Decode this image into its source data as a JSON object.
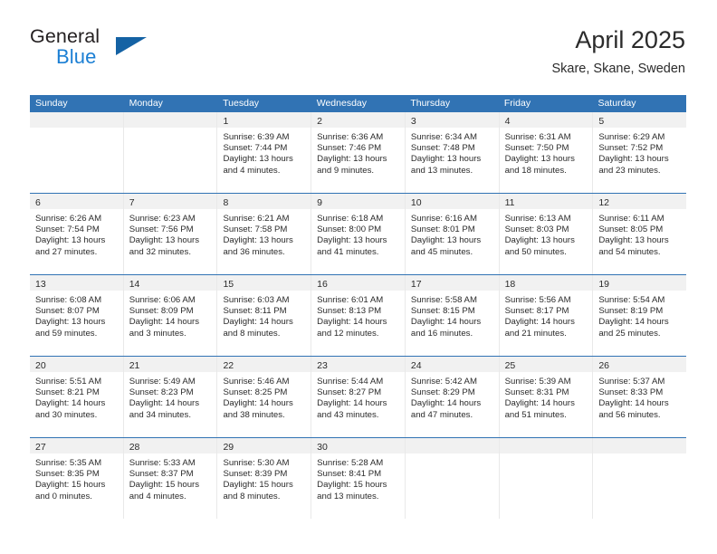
{
  "brand": {
    "name_dark": "General",
    "name_blue": "Blue",
    "triangle_color": "#1462a4",
    "blue_color": "#1b7fd4"
  },
  "header": {
    "title": "April 2025",
    "location": "Skare, Skane, Sweden"
  },
  "theme": {
    "header_blue": "#3173b4",
    "date_band_gray": "#f1f1f1",
    "text": "#2b2b2b"
  },
  "weekdays": [
    "Sunday",
    "Monday",
    "Tuesday",
    "Wednesday",
    "Thursday",
    "Friday",
    "Saturday"
  ],
  "labels": {
    "sunrise_prefix": "Sunrise:",
    "sunset_prefix": "Sunset:",
    "daylight_prefix": "Daylight:"
  },
  "weeks": [
    [
      {
        "date": "",
        "sunrise": "",
        "sunset": "",
        "daylight": ""
      },
      {
        "date": "",
        "sunrise": "",
        "sunset": "",
        "daylight": ""
      },
      {
        "date": "1",
        "sunrise": "Sunrise: 6:39 AM",
        "sunset": "Sunset: 7:44 PM",
        "daylight": "Daylight: 13 hours and 4 minutes."
      },
      {
        "date": "2",
        "sunrise": "Sunrise: 6:36 AM",
        "sunset": "Sunset: 7:46 PM",
        "daylight": "Daylight: 13 hours and 9 minutes."
      },
      {
        "date": "3",
        "sunrise": "Sunrise: 6:34 AM",
        "sunset": "Sunset: 7:48 PM",
        "daylight": "Daylight: 13 hours and 13 minutes."
      },
      {
        "date": "4",
        "sunrise": "Sunrise: 6:31 AM",
        "sunset": "Sunset: 7:50 PM",
        "daylight": "Daylight: 13 hours and 18 minutes."
      },
      {
        "date": "5",
        "sunrise": "Sunrise: 6:29 AM",
        "sunset": "Sunset: 7:52 PM",
        "daylight": "Daylight: 13 hours and 23 minutes."
      }
    ],
    [
      {
        "date": "6",
        "sunrise": "Sunrise: 6:26 AM",
        "sunset": "Sunset: 7:54 PM",
        "daylight": "Daylight: 13 hours and 27 minutes."
      },
      {
        "date": "7",
        "sunrise": "Sunrise: 6:23 AM",
        "sunset": "Sunset: 7:56 PM",
        "daylight": "Daylight: 13 hours and 32 minutes."
      },
      {
        "date": "8",
        "sunrise": "Sunrise: 6:21 AM",
        "sunset": "Sunset: 7:58 PM",
        "daylight": "Daylight: 13 hours and 36 minutes."
      },
      {
        "date": "9",
        "sunrise": "Sunrise: 6:18 AM",
        "sunset": "Sunset: 8:00 PM",
        "daylight": "Daylight: 13 hours and 41 minutes."
      },
      {
        "date": "10",
        "sunrise": "Sunrise: 6:16 AM",
        "sunset": "Sunset: 8:01 PM",
        "daylight": "Daylight: 13 hours and 45 minutes."
      },
      {
        "date": "11",
        "sunrise": "Sunrise: 6:13 AM",
        "sunset": "Sunset: 8:03 PM",
        "daylight": "Daylight: 13 hours and 50 minutes."
      },
      {
        "date": "12",
        "sunrise": "Sunrise: 6:11 AM",
        "sunset": "Sunset: 8:05 PM",
        "daylight": "Daylight: 13 hours and 54 minutes."
      }
    ],
    [
      {
        "date": "13",
        "sunrise": "Sunrise: 6:08 AM",
        "sunset": "Sunset: 8:07 PM",
        "daylight": "Daylight: 13 hours and 59 minutes."
      },
      {
        "date": "14",
        "sunrise": "Sunrise: 6:06 AM",
        "sunset": "Sunset: 8:09 PM",
        "daylight": "Daylight: 14 hours and 3 minutes."
      },
      {
        "date": "15",
        "sunrise": "Sunrise: 6:03 AM",
        "sunset": "Sunset: 8:11 PM",
        "daylight": "Daylight: 14 hours and 8 minutes."
      },
      {
        "date": "16",
        "sunrise": "Sunrise: 6:01 AM",
        "sunset": "Sunset: 8:13 PM",
        "daylight": "Daylight: 14 hours and 12 minutes."
      },
      {
        "date": "17",
        "sunrise": "Sunrise: 5:58 AM",
        "sunset": "Sunset: 8:15 PM",
        "daylight": "Daylight: 14 hours and 16 minutes."
      },
      {
        "date": "18",
        "sunrise": "Sunrise: 5:56 AM",
        "sunset": "Sunset: 8:17 PM",
        "daylight": "Daylight: 14 hours and 21 minutes."
      },
      {
        "date": "19",
        "sunrise": "Sunrise: 5:54 AM",
        "sunset": "Sunset: 8:19 PM",
        "daylight": "Daylight: 14 hours and 25 minutes."
      }
    ],
    [
      {
        "date": "20",
        "sunrise": "Sunrise: 5:51 AM",
        "sunset": "Sunset: 8:21 PM",
        "daylight": "Daylight: 14 hours and 30 minutes."
      },
      {
        "date": "21",
        "sunrise": "Sunrise: 5:49 AM",
        "sunset": "Sunset: 8:23 PM",
        "daylight": "Daylight: 14 hours and 34 minutes."
      },
      {
        "date": "22",
        "sunrise": "Sunrise: 5:46 AM",
        "sunset": "Sunset: 8:25 PM",
        "daylight": "Daylight: 14 hours and 38 minutes."
      },
      {
        "date": "23",
        "sunrise": "Sunrise: 5:44 AM",
        "sunset": "Sunset: 8:27 PM",
        "daylight": "Daylight: 14 hours and 43 minutes."
      },
      {
        "date": "24",
        "sunrise": "Sunrise: 5:42 AM",
        "sunset": "Sunset: 8:29 PM",
        "daylight": "Daylight: 14 hours and 47 minutes."
      },
      {
        "date": "25",
        "sunrise": "Sunrise: 5:39 AM",
        "sunset": "Sunset: 8:31 PM",
        "daylight": "Daylight: 14 hours and 51 minutes."
      },
      {
        "date": "26",
        "sunrise": "Sunrise: 5:37 AM",
        "sunset": "Sunset: 8:33 PM",
        "daylight": "Daylight: 14 hours and 56 minutes."
      }
    ],
    [
      {
        "date": "27",
        "sunrise": "Sunrise: 5:35 AM",
        "sunset": "Sunset: 8:35 PM",
        "daylight": "Daylight: 15 hours and 0 minutes."
      },
      {
        "date": "28",
        "sunrise": "Sunrise: 5:33 AM",
        "sunset": "Sunset: 8:37 PM",
        "daylight": "Daylight: 15 hours and 4 minutes."
      },
      {
        "date": "29",
        "sunrise": "Sunrise: 5:30 AM",
        "sunset": "Sunset: 8:39 PM",
        "daylight": "Daylight: 15 hours and 8 minutes."
      },
      {
        "date": "30",
        "sunrise": "Sunrise: 5:28 AM",
        "sunset": "Sunset: 8:41 PM",
        "daylight": "Daylight: 15 hours and 13 minutes."
      },
      {
        "date": "",
        "sunrise": "",
        "sunset": "",
        "daylight": ""
      },
      {
        "date": "",
        "sunrise": "",
        "sunset": "",
        "daylight": ""
      },
      {
        "date": "",
        "sunrise": "",
        "sunset": "",
        "daylight": ""
      }
    ]
  ]
}
